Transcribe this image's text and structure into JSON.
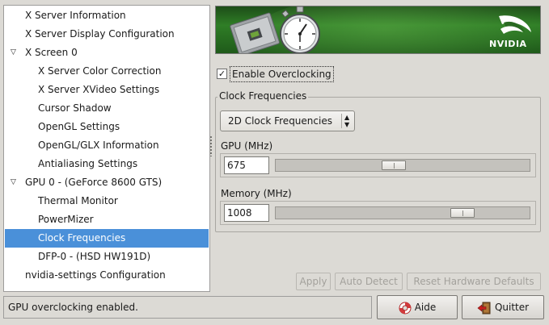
{
  "tree": {
    "items": [
      {
        "label": "X Server Information",
        "level": 0
      },
      {
        "label": "X Server Display Configuration",
        "level": 0
      },
      {
        "label": "X Screen 0",
        "level": 0,
        "expander": "▽"
      },
      {
        "label": "X Server Color Correction",
        "level": 1
      },
      {
        "label": "X Server XVideo Settings",
        "level": 1
      },
      {
        "label": "Cursor Shadow",
        "level": 1
      },
      {
        "label": "OpenGL Settings",
        "level": 1
      },
      {
        "label": "OpenGL/GLX Information",
        "level": 1
      },
      {
        "label": "Antialiasing Settings",
        "level": 1
      },
      {
        "label": "GPU 0 - (GeForce 8600 GTS)",
        "level": 0,
        "expander": "▽"
      },
      {
        "label": "Thermal Monitor",
        "level": 1
      },
      {
        "label": "PowerMizer",
        "level": 1
      },
      {
        "label": "Clock Frequencies",
        "level": 1,
        "selected": true
      },
      {
        "label": "DFP-0 - (HSD HW191D)",
        "level": 1
      },
      {
        "label": "nvidia-settings Configuration",
        "level": 0
      }
    ]
  },
  "banner": {
    "logo_text": "NVIDIA",
    "colors": {
      "accent": "#4a90d9",
      "brand": "#76b900"
    }
  },
  "overclock": {
    "checkbox_label": "Enable Overclocking",
    "checked": true,
    "check_glyph": "✓"
  },
  "clock": {
    "frame_title": "Clock Frequencies",
    "mode_select": "2D Clock Frequencies",
    "mode_arrows": "▲▼",
    "gpu": {
      "label": "GPU (MHz)",
      "value": "675",
      "level": 0.46
    },
    "memory": {
      "label": "Memory (MHz)",
      "value": "1008",
      "level": 0.76
    }
  },
  "actions": {
    "apply": "Apply",
    "auto_detect": "Auto Detect",
    "reset": "Reset Hardware Defaults"
  },
  "status": {
    "text": "GPU overclocking enabled."
  },
  "footer": {
    "help": "Aide",
    "quit": "Quitter"
  }
}
